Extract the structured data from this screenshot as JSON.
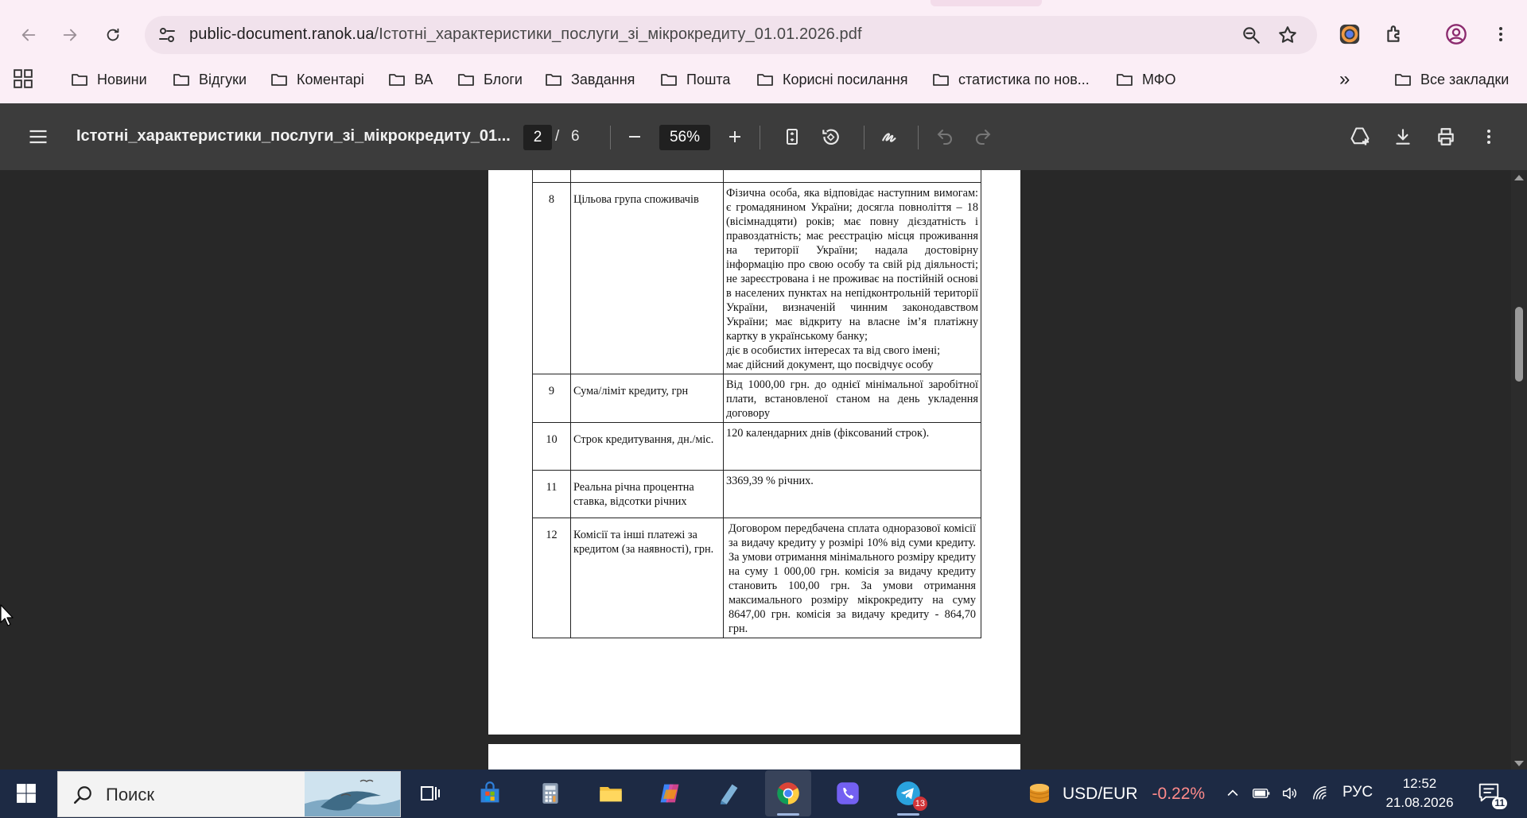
{
  "browser": {
    "url_host": "public-document.ranok.ua",
    "url_path": "/Істотні_характеристики_послуги_зі_мікрокредиту_01.01.2026.pdf",
    "icons": [
      "back-icon",
      "forward-icon",
      "reload-icon",
      "site-info-icon",
      "zoom-icon",
      "bookmark-star-icon",
      "color-extension-icon",
      "extensions-icon",
      "profile-icon",
      "more-icon"
    ]
  },
  "bookmarks": {
    "items": [
      "Новини",
      "Відгуки",
      "Коментарі",
      "ВА",
      "Блоги",
      "Завдання",
      "Пошта",
      "Корисні посилання",
      "статистика по нов...",
      "МФО"
    ],
    "overflow": "»",
    "all": "Все закладки"
  },
  "pdf_toolbar": {
    "title": "Істотні_характеристики_послуги_зі_мікрокредиту_01...",
    "current_page": "2",
    "separator": "/",
    "total_pages": "6",
    "zoom": "56%",
    "zoom_out": "−",
    "zoom_in": "+"
  },
  "document": {
    "rows": [
      {
        "num": "8",
        "label": "Цільова група споживачів",
        "value_lines": [
          "Фізична особа, яка відповідає наступним вимогам: є громадянином України; досягла повноліття – 18 (вісімнадцяти) років; має повну дієздатність і правоздатність; має реєстрацію місця проживання на території України; надала достовірну інформацію про свою особу та свій рід діяльності; не зареєстрована і не проживає на постійній основі в населених пунктах на непідконтрольній території України, визначеній чинним законодавством України; має відкриту на власне ім’я платіжну картку в українському банку;",
          "діє в особистих інтересах та від свого імені;",
          "має дійсний документ, що посвідчує особу"
        ]
      },
      {
        "num": "9",
        "label": "Сума/ліміт кредиту, грн",
        "value_lines": [
          "Від 1000,00 грн. до однієї мінімальної заробітної плати, встановленої станом на день укладення договору"
        ]
      },
      {
        "num": "10",
        "label": "Строк кредитування, дн./міс.",
        "value_lines": [
          "120 календарних днів (фіксований строк)."
        ]
      },
      {
        "num": "11",
        "label": "Реальна річна процентна ставка, відсотки річних",
        "value_lines": [
          "3369,39 % річних."
        ]
      },
      {
        "num": "12",
        "label": "Комісії та інші платежі за кредитом (за наявності), грн.",
        "value_lines": [
          "Договором передбачена сплата одноразової комісії за видачу кредиту у розмірі 10% від суми кредиту. За умови отримання мінімального розміру кредиту на суму 1 000,00 грн. комісія за видачу кредиту становить 100,00 грн. За умови отримання максимального розміру мікрокредиту на суму 8647,00 грн. комісія за видачу кредиту - 864,70 грн."
        ]
      }
    ]
  },
  "taskbar": {
    "search_placeholder": "Поиск",
    "ticker_label": "USD/EUR",
    "ticker_change": "-0.22%",
    "ticker_change_color": "#ff8a8a",
    "telegram_badge": "13",
    "language": "РУС",
    "time": "12:52",
    "date": "21.08.2026",
    "notifications_count": "11"
  }
}
